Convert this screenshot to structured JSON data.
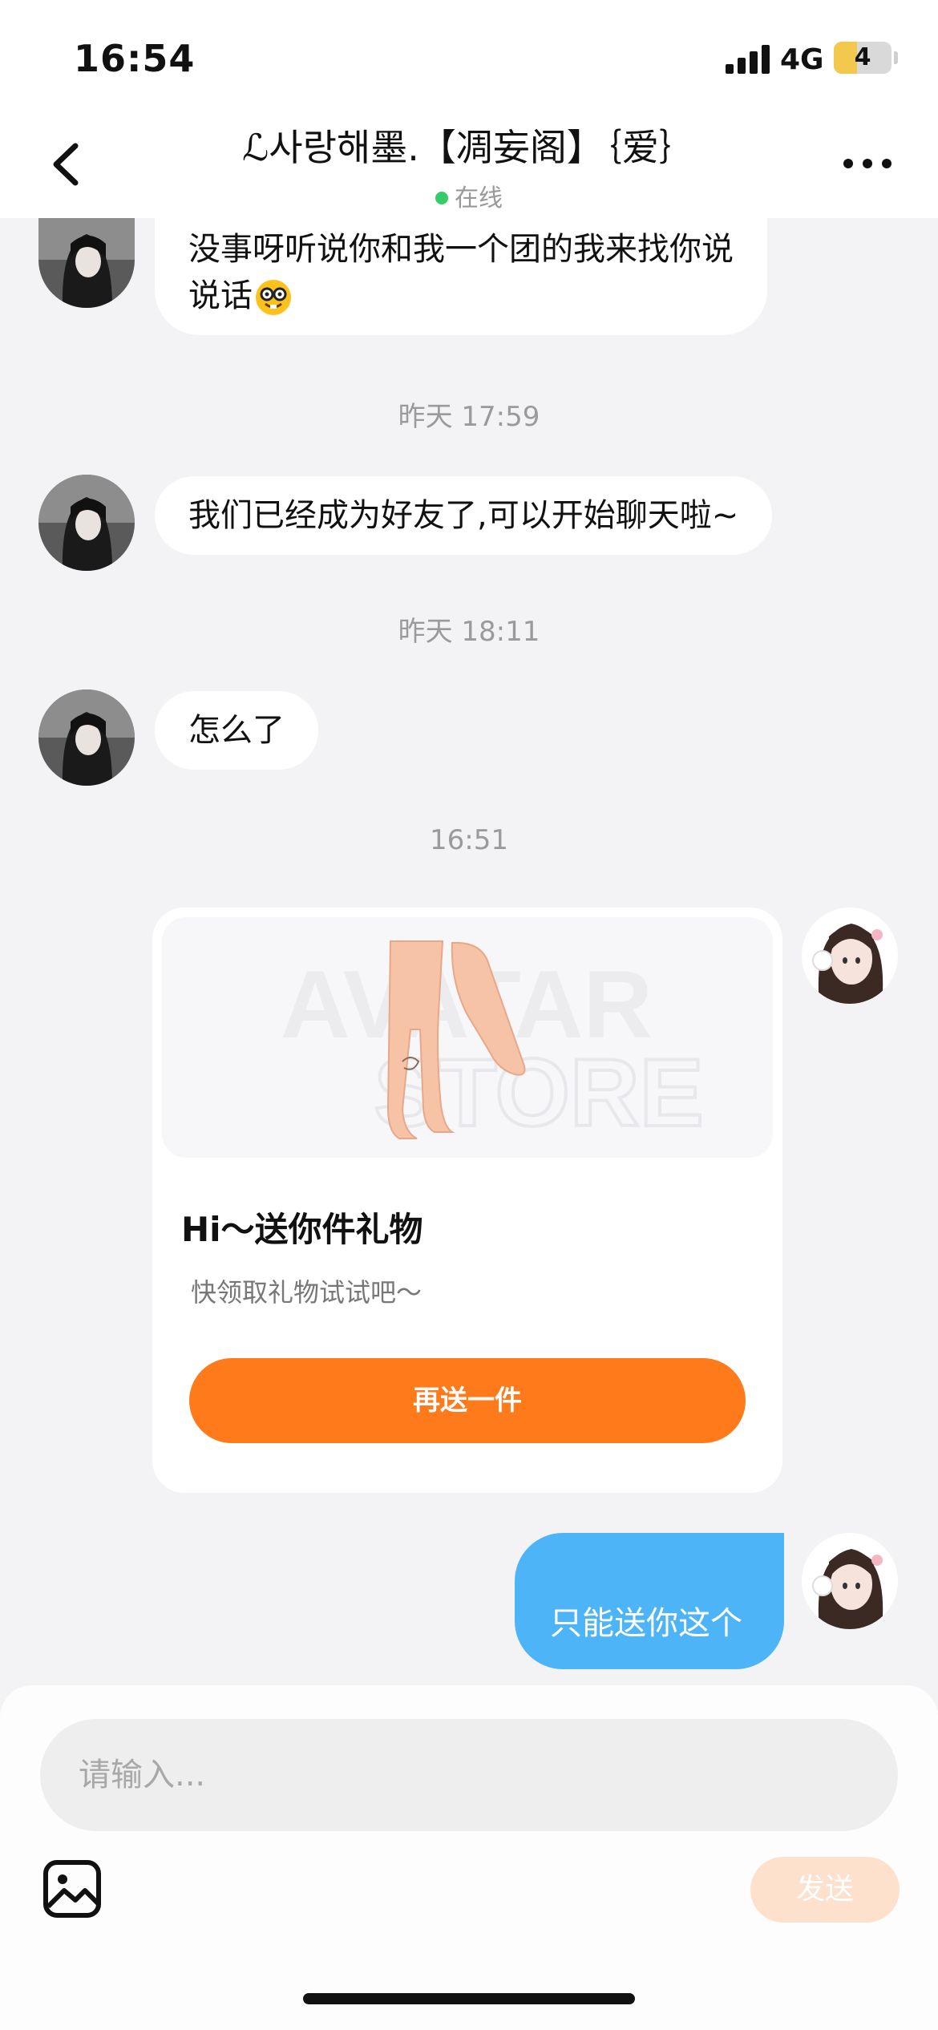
{
  "status_bar": {
    "time": "16:54",
    "network": "4G",
    "battery": "4",
    "battery_level_percent": 40
  },
  "header": {
    "title": "ℒ사랑해墨.【凋妄阁】｛爱｝",
    "status": "在线",
    "status_color": "#33cc66"
  },
  "messages": {
    "m1": {
      "line1": "没事呀听说你和我一个团的我来找你说",
      "line2": "说话",
      "emoji": "nerd-face-emoji"
    },
    "t1": "昨天 17:59",
    "m2": "我们已经成为好友了,可以开始聊天啦~",
    "t2": "昨天 18:11",
    "m3": "怎么了",
    "t3": "16:51",
    "gift": {
      "title": "Hi～送你件礼物",
      "subtitle": "快领取礼物试试吧～",
      "button": "再送一件",
      "watermark_line1": "AVATAR",
      "watermark_line2": "STORE",
      "button_color": "#ff7a1a"
    },
    "m4": "只能送你这个",
    "outgoing_color": "#4db5f7"
  },
  "composer": {
    "placeholder": "请输入...",
    "send": "发送"
  }
}
